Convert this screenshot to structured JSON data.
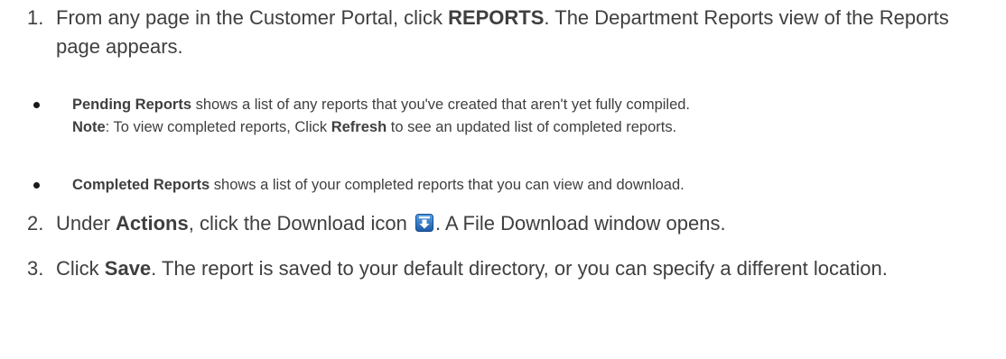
{
  "steps": {
    "step1": {
      "number": "1.",
      "pre": "From any page in the Customer Portal, click ",
      "bold": "REPORTS",
      "post": ". The Department Reports view of the Reports page appears."
    },
    "bullet_pending": {
      "bold": "Pending Reports",
      "text": " shows a list of any reports that you've created that aren't yet fully compiled.",
      "note_label": "Note",
      "note_pre": ": To view completed reports, Click ",
      "note_bold": "Refresh",
      "note_post": " to see an updated list of completed reports."
    },
    "bullet_completed": {
      "bold": "Completed Reports",
      "text": " shows a list of your completed reports that you can view and download."
    },
    "step2": {
      "number": "2.",
      "pre": "Under ",
      "bold": "Actions",
      "mid": ", click the Download icon ",
      "icon": "download-icon",
      "post": ". A File Download window opens."
    },
    "step3": {
      "number": "3.",
      "pre": "Click ",
      "bold": "Save",
      "post": ". The report is saved to your default directory, or you can specify a different location."
    }
  },
  "colors": {
    "text": "#3f3f3f",
    "bullet": "#1a1a1a",
    "icon_blue": "#2f7fd0",
    "icon_dark": "#1d5aa6"
  }
}
